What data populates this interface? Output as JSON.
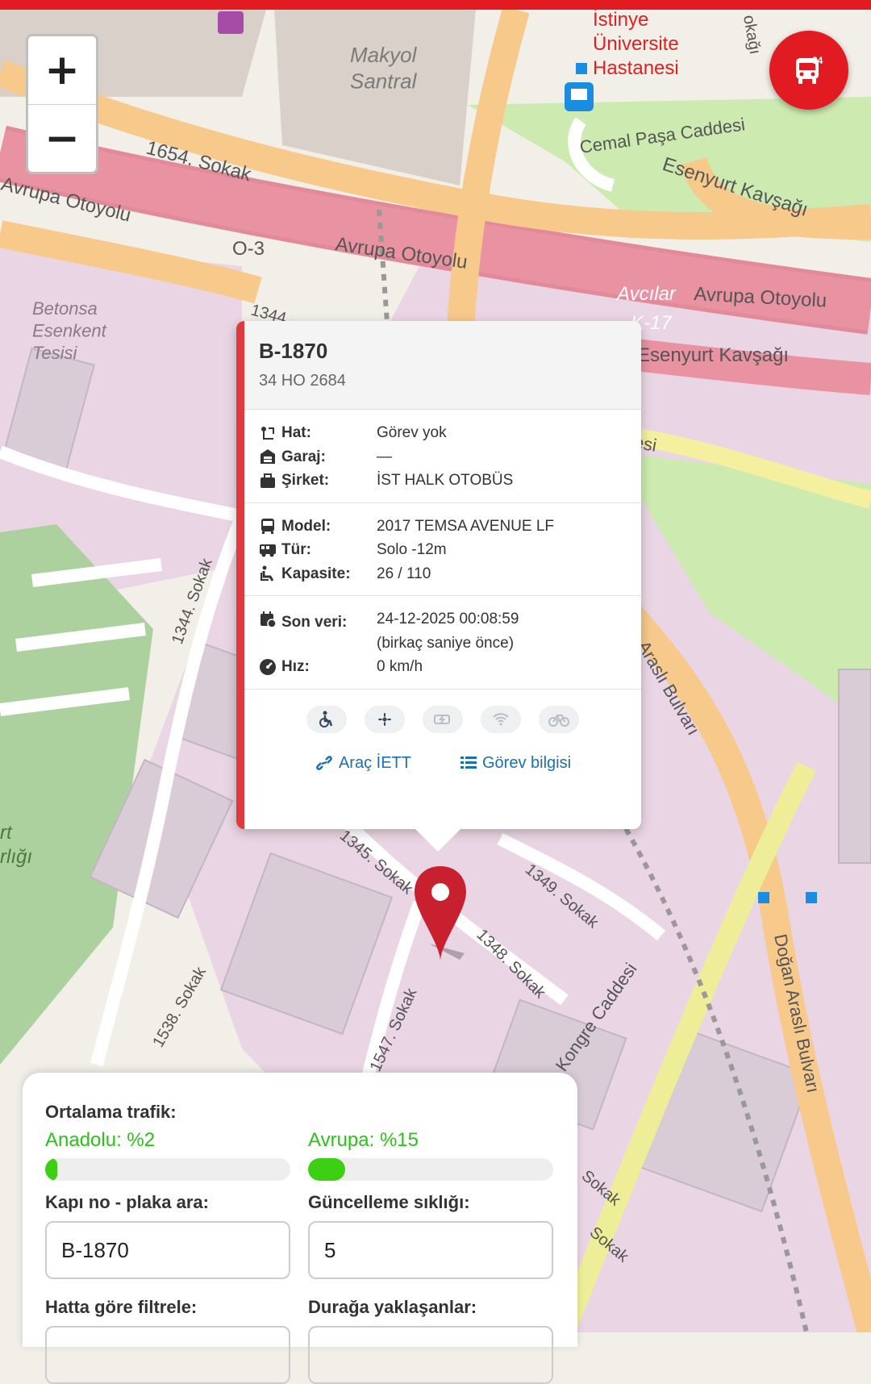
{
  "map": {
    "labels": {
      "makyol": "Makyol\nSantral",
      "istinye": "İstinye\nÜniversite\nHastanesi",
      "cemal": "Cemal Paşa Caddesi",
      "esenyurt1": "Esenyurt Kavşağı",
      "esenyurt2": "Esenyurt Kavşağı",
      "sokak1654": "1654. Sokak",
      "avrupa1": "Avrupa Otoyolu",
      "avrupa2": "Avrupa Otoyolu",
      "avrupa3": "Avrupa Otoyolu",
      "o3": "O-3",
      "avcilar": "Avcılar",
      "k17": "K-17",
      "betonsa": "Betonsa\nEsenkent\nTesisi",
      "sokak1344": "1344. Sokak",
      "sokak1344b": "1344",
      "arasli": "Araslı Bulvarı",
      "dogan": "Doğan Araslı Bulvarı",
      "sokak1349": "1349. Sokak",
      "sokak1348": "1348. Sokak",
      "sokak1345": "1345. Sokak",
      "sokak1547": "1547. Sokak",
      "sokak1538": "1538. Sokak",
      "kongre": "Kongre Caddesi",
      "rtk": "rt\nrlığı",
      "sokakR1": "Sokak",
      "sokakR2": "Sokak",
      "okagi": "okağı",
      "esi": "esi"
    }
  },
  "zoom": {
    "in_label": "+",
    "out_label": "−"
  },
  "bus_count": "34",
  "popup": {
    "title": "B-1870",
    "plate": "34 HO 2684",
    "rows1": [
      {
        "label": "Hat:",
        "value": "Görev yok",
        "icon": "route-icon"
      },
      {
        "label": "Garaj:",
        "value": "—",
        "icon": "garage-icon"
      },
      {
        "label": "Şirket:",
        "value": "İST HALK OTOBÜS",
        "icon": "briefcase-icon"
      }
    ],
    "rows2": [
      {
        "label": "Model:",
        "value": "2017 TEMSA AVENUE LF",
        "icon": "bus-icon"
      },
      {
        "label": "Tür:",
        "value": "Solo -12m",
        "icon": "bus-side-icon"
      },
      {
        "label": "Kapasite:",
        "value": "26 / 110",
        "icon": "seat-icon"
      }
    ],
    "son_veri_label": "Son veri:",
    "son_veri_value": "24-12-2025 00:08:59",
    "son_veri_rel": "(birkaç saniye önce)",
    "hiz_label": "Hız:",
    "hiz_value": "0 km/h",
    "link_iett": "Araç İETT",
    "link_gorev": "Görev bilgisi"
  },
  "panel": {
    "traffic_label": "Ortalama trafik:",
    "anadolu_label": "Anadolu: %2",
    "anadolu_pct": 2,
    "avrupa_label": "Avrupa: %15",
    "avrupa_pct": 15,
    "search_label": "Kapı no - plaka ara:",
    "search_value": "B-1870",
    "freq_label": "Güncelleme sıklığı:",
    "freq_value": "5",
    "filter_label": "Hatta göre filtrele:",
    "approach_label": "Durağa yaklaşanlar:"
  },
  "colors": {
    "brand": "#e21b23",
    "accent_green": "#2cc11a",
    "link": "#1b6fb3"
  }
}
